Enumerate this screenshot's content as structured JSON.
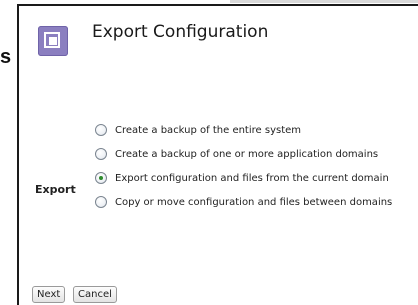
{
  "page": {
    "left_edge_fragment": "s"
  },
  "dialog": {
    "title": "Export Configuration",
    "logo_icon": "square-target-icon",
    "accent_color": "#8b7fc0",
    "group_label": "Export",
    "options": [
      {
        "label": "Create a backup of the entire system",
        "selected": false
      },
      {
        "label": "Create a backup of one or more application domains",
        "selected": false
      },
      {
        "label": "Export configuration and files from the current domain",
        "selected": true
      },
      {
        "label": "Copy or move configuration and files between domains",
        "selected": false
      }
    ],
    "buttons": {
      "next_label": "Next",
      "cancel_label": "Cancel"
    }
  }
}
